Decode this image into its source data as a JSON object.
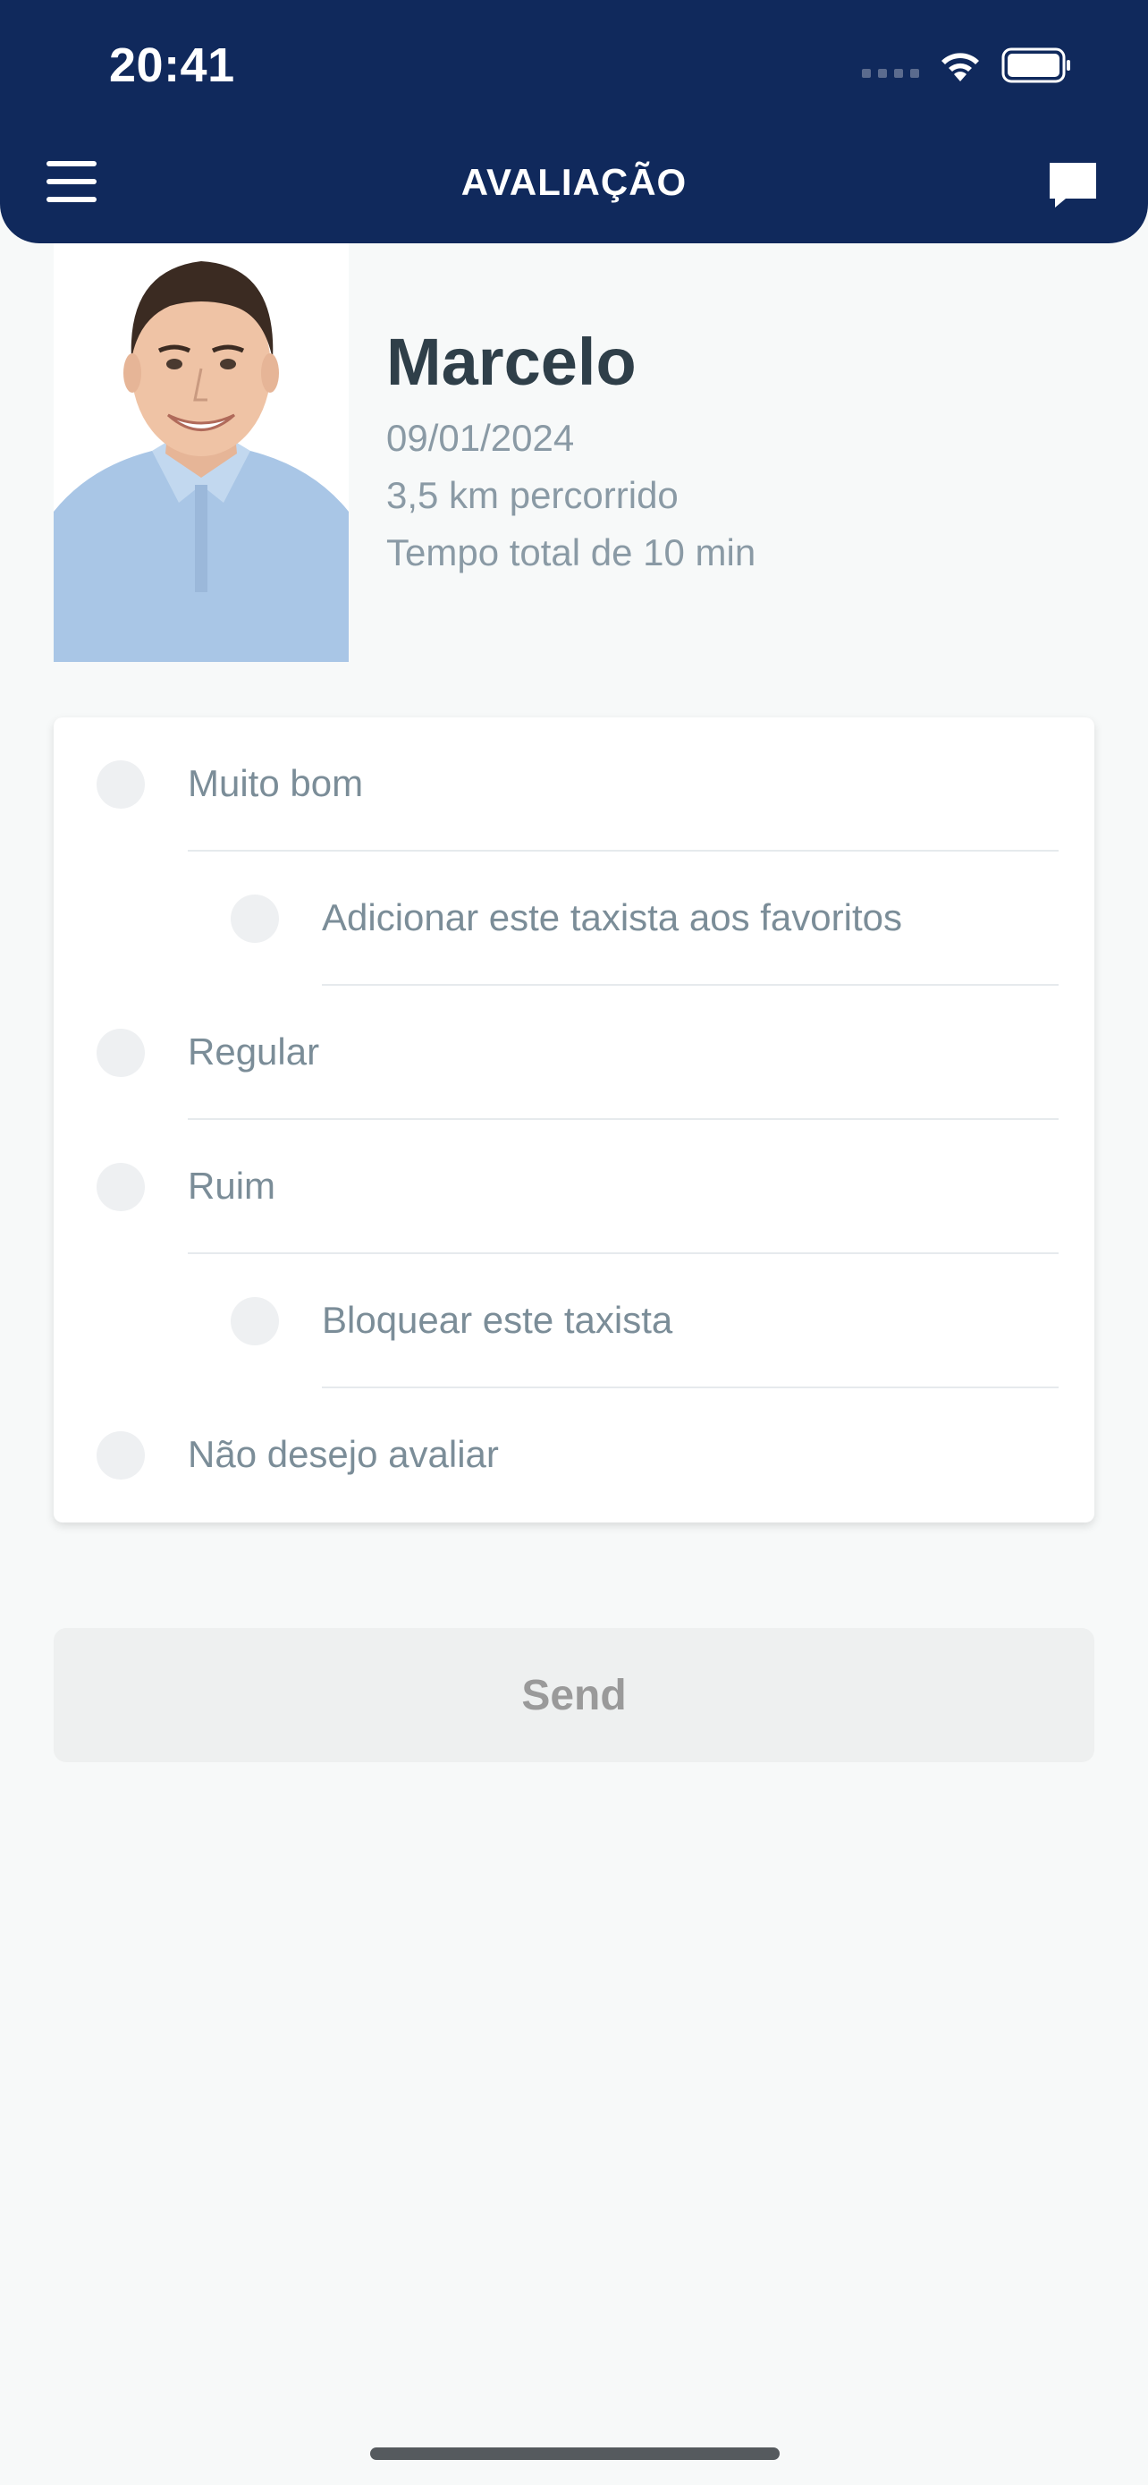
{
  "status_bar": {
    "time": "20:41"
  },
  "header": {
    "title": "AVALIAÇÃO"
  },
  "driver": {
    "name": "Marcelo",
    "date": "09/01/2024",
    "distance": "3,5 km percorrido",
    "total_time": "Tempo total de 10 min"
  },
  "rating": {
    "options": [
      {
        "label": "Muito bom",
        "level": "main"
      },
      {
        "label": "Adicionar este taxista aos favoritos",
        "level": "sub"
      },
      {
        "label": "Regular",
        "level": "main"
      },
      {
        "label": "Ruim",
        "level": "main"
      },
      {
        "label": "Bloquear este taxista",
        "level": "sub"
      },
      {
        "label": "Não desejo avaliar",
        "level": "main"
      }
    ]
  },
  "actions": {
    "send_label": "Send"
  },
  "colors": {
    "header_bg": "#10295c",
    "page_bg": "#f7f9f9",
    "name_text": "#2f3f49",
    "meta_text": "#8a9aa5",
    "option_text": "#7b8d98"
  },
  "icons": {
    "menu": "hamburger-menu-icon",
    "chat": "chat-bubble-icon",
    "wifi": "wifi-icon",
    "battery": "battery-icon"
  }
}
